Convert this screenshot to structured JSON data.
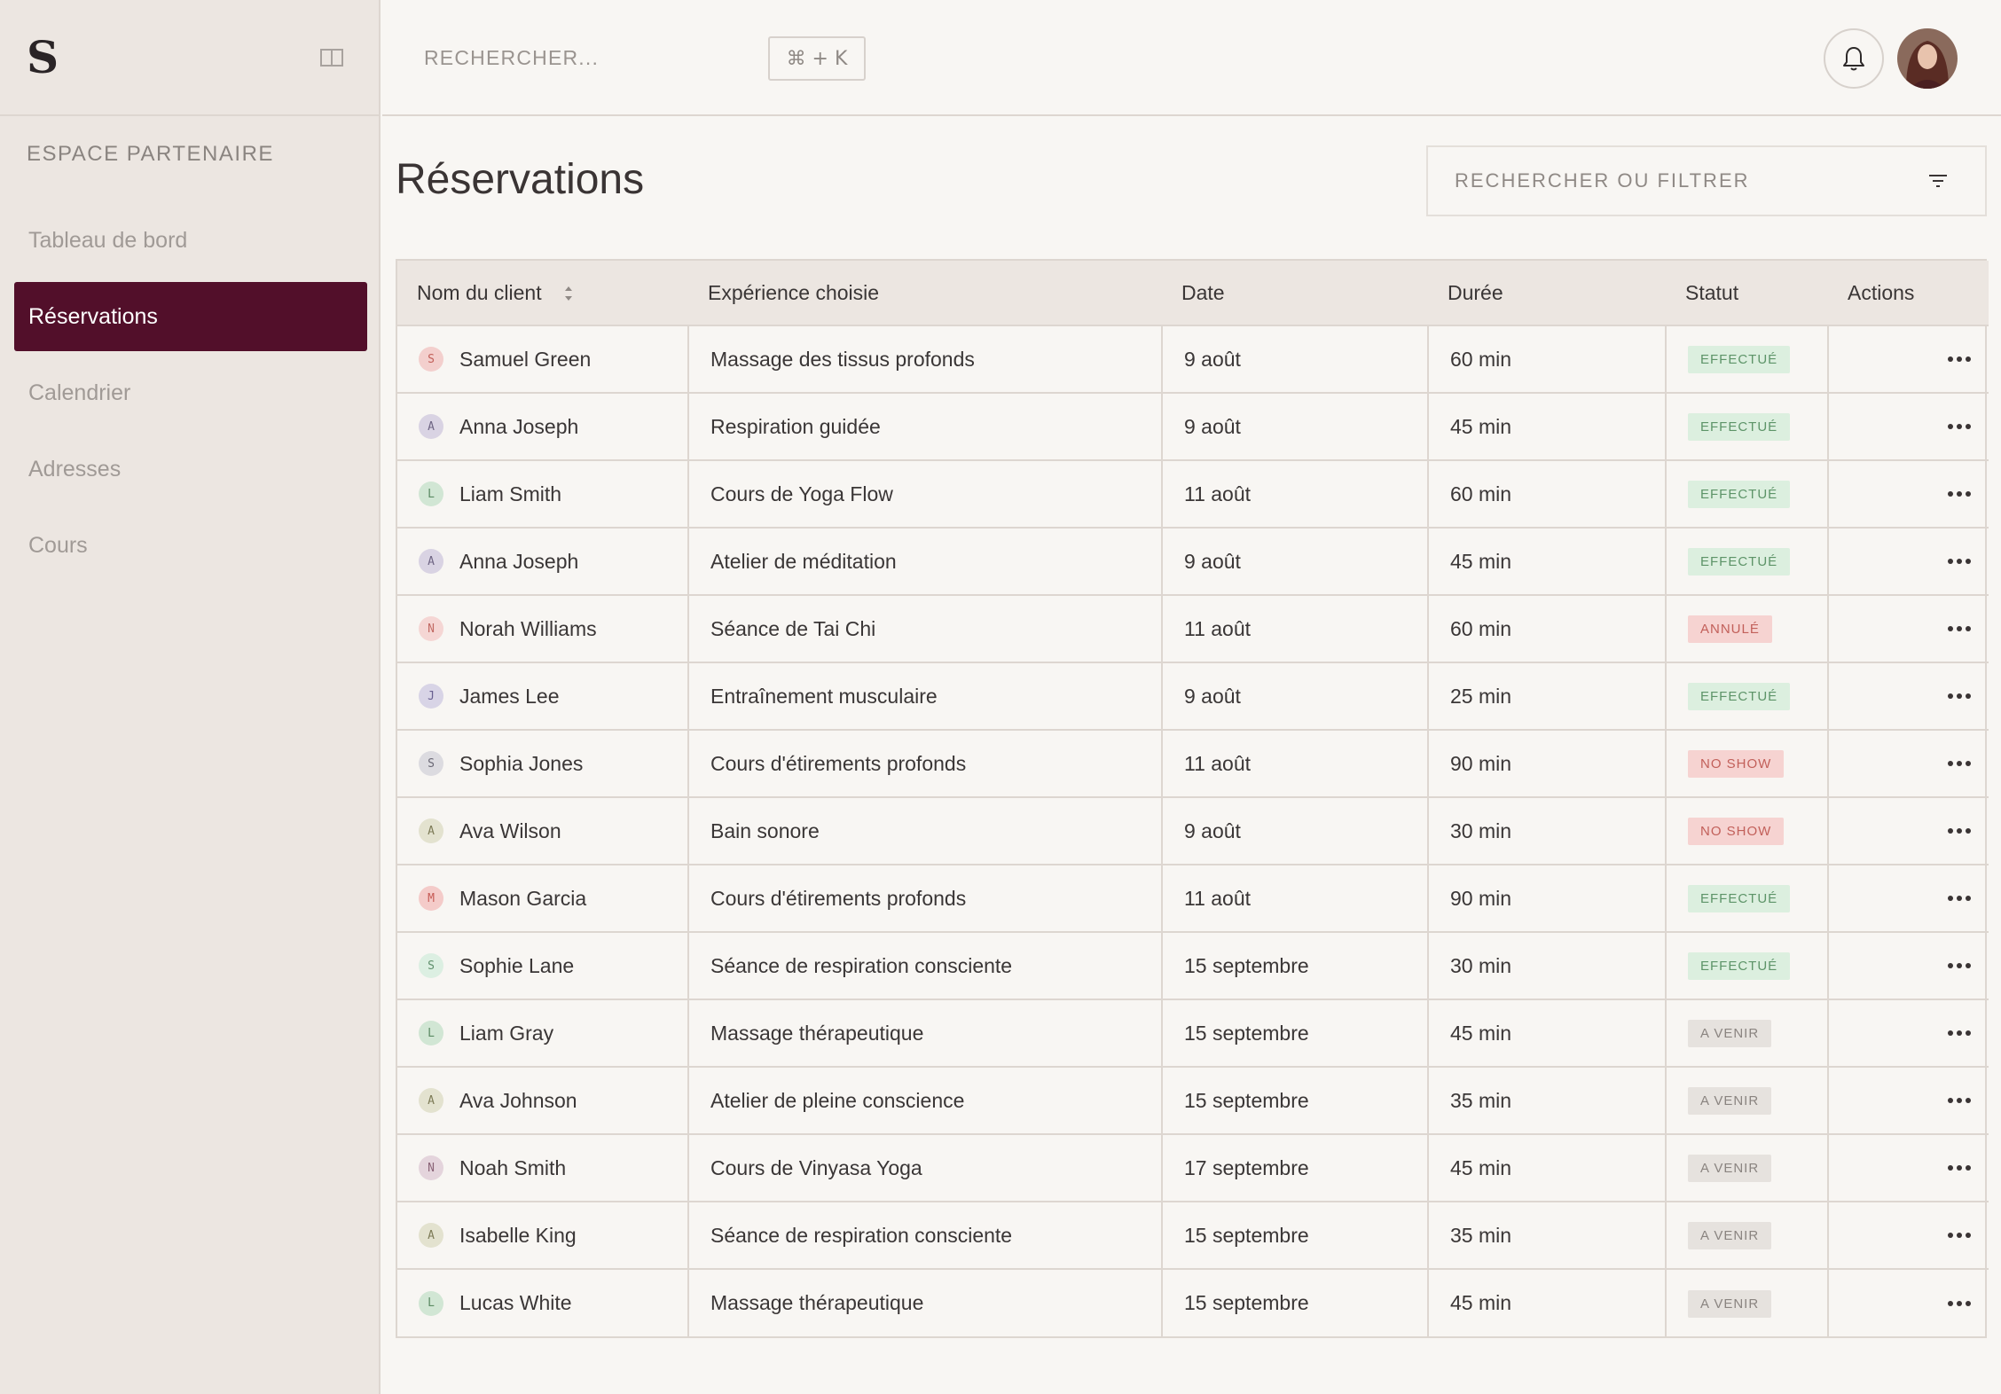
{
  "sidebar": {
    "logo": "S",
    "section_title": "ESPACE PARTENAIRE",
    "items": [
      {
        "label": "Tableau de bord",
        "active": false
      },
      {
        "label": "Réservations",
        "active": true
      },
      {
        "label": "Calendrier",
        "active": false
      },
      {
        "label": "Adresses",
        "active": false
      },
      {
        "label": "Cours",
        "active": false
      }
    ]
  },
  "topbar": {
    "search_placeholder": "RECHERCHER...",
    "shortcut": "⌘ + K"
  },
  "main": {
    "title": "Réservations",
    "filter_placeholder": "RECHERCHER OU FILTRER"
  },
  "table": {
    "columns": [
      "Nom du client",
      "Expérience choisie",
      "Date",
      "Durée",
      "Statut",
      "Actions"
    ],
    "rows": [
      {
        "initial": "S",
        "avatar_color": "#f3cfcd",
        "initial_color": "#c2605a",
        "name": "Samuel Green",
        "experience": "Massage des tissus profonds",
        "date": "9 août",
        "duration": "60 min",
        "status": "EFFECTUÉ"
      },
      {
        "initial": "A",
        "avatar_color": "#d9d3e3",
        "initial_color": "#6f6584",
        "name": "Anna Joseph",
        "experience": "Respiration guidée",
        "date": "9 août",
        "duration": "45 min",
        "status": "EFFECTUÉ"
      },
      {
        "initial": "L",
        "avatar_color": "#d1e6d4",
        "initial_color": "#5b8a63",
        "name": "Liam Smith",
        "experience": "Cours de Yoga Flow",
        "date": "11 août",
        "duration": "60 min",
        "status": "EFFECTUÉ"
      },
      {
        "initial": "A",
        "avatar_color": "#d9d3e3",
        "initial_color": "#6f6584",
        "name": "Anna Joseph",
        "experience": "Atelier de méditation",
        "date": "9 août",
        "duration": "45 min",
        "status": "EFFECTUÉ"
      },
      {
        "initial": "N",
        "avatar_color": "#f5d6d4",
        "initial_color": "#c26a64",
        "name": "Norah Williams",
        "experience": "Séance de Tai Chi",
        "date": "11 août",
        "duration": "60 min",
        "status": "ANNULÉ"
      },
      {
        "initial": "J",
        "avatar_color": "#d8d4e6",
        "initial_color": "#686090",
        "name": "James Lee",
        "experience": "Entraînement musculaire",
        "date": "9 août",
        "duration": "25 min",
        "status": "EFFECTUÉ"
      },
      {
        "initial": "S",
        "avatar_color": "#dcdbe0",
        "initial_color": "#6a6875",
        "name": "Sophia Jones",
        "experience": "Cours d'étirements profonds",
        "date": "11 août",
        "duration": "90 min",
        "status": "NO SHOW"
      },
      {
        "initial": "A",
        "avatar_color": "#e3e2cf",
        "initial_color": "#7d7b57",
        "name": "Ava Wilson",
        "experience": "Bain sonore",
        "date": "9 août",
        "duration": "30 min",
        "status": "NO SHOW"
      },
      {
        "initial": "M",
        "avatar_color": "#f4cbc9",
        "initial_color": "#c65a55",
        "name": "Mason Garcia",
        "experience": "Cours d'étirements profonds",
        "date": "11 août",
        "duration": "90 min",
        "status": "EFFECTUÉ"
      },
      {
        "initial": "S",
        "avatar_color": "#dcefe2",
        "initial_color": "#5f8f6c",
        "name": "Sophie Lane",
        "experience": "Séance de respiration consciente",
        "date": "15 septembre",
        "duration": "30 min",
        "status": "EFFECTUÉ"
      },
      {
        "initial": "L",
        "avatar_color": "#d1e6d4",
        "initial_color": "#5b8a63",
        "name": "Liam Gray",
        "experience": "Massage thérapeutique",
        "date": "15 septembre",
        "duration": "45 min",
        "status": "A VENIR"
      },
      {
        "initial": "A",
        "avatar_color": "#e3e2cf",
        "initial_color": "#7d7b57",
        "name": "Ava Johnson",
        "experience": "Atelier de pleine conscience",
        "date": "15 septembre",
        "duration": "35 min",
        "status": "A VENIR"
      },
      {
        "initial": "N",
        "avatar_color": "#e4d4dc",
        "initial_color": "#8a6377",
        "name": "Noah Smith",
        "experience": "Cours de Vinyasa Yoga",
        "date": "17 septembre",
        "duration": "45 min",
        "status": "A VENIR"
      },
      {
        "initial": "A",
        "avatar_color": "#e3e2cf",
        "initial_color": "#7d7b57",
        "name": "Isabelle King",
        "experience": "Séance de respiration consciente",
        "date": "15 septembre",
        "duration": "35 min",
        "status": "A VENIR"
      },
      {
        "initial": "L",
        "avatar_color": "#d1e6d4",
        "initial_color": "#5b8a63",
        "name": "Lucas White",
        "experience": "Massage thérapeutique",
        "date": "15 septembre",
        "duration": "45 min",
        "status": "A VENIR"
      }
    ]
  },
  "status_colors": {
    "EFFECTUÉ": {
      "bg": "#dcefdf",
      "fg": "#5d9468"
    },
    "ANNULÉ": {
      "bg": "#f6d3d1",
      "fg": "#c2605a"
    },
    "NO SHOW": {
      "bg": "#f6d3d1",
      "fg": "#c2605a"
    },
    "A VENIR": {
      "bg": "#e6e2de",
      "fg": "#8a8480"
    }
  },
  "colors": {
    "accent": "#520f2a",
    "sidebar_bg": "#ece6e1",
    "page_bg": "#f8f6f3"
  }
}
